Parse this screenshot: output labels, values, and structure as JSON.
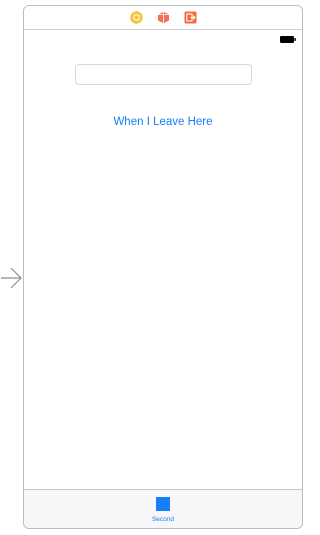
{
  "scene": {
    "dock_icons": [
      "view-controller-icon",
      "first-responder-icon",
      "exit-icon"
    ],
    "status_bar": {
      "battery_icon": "battery-icon"
    },
    "text_field": {
      "value": "",
      "placeholder": ""
    },
    "button": {
      "label": "When I Leave Here"
    },
    "tab_bar": {
      "items": [
        {
          "label": "Second",
          "icon": "square-icon",
          "selected": true
        }
      ]
    }
  },
  "colors": {
    "accent": "#147EFB",
    "dock_view_controller": "#F5C33B",
    "dock_first_responder": "#F0705A",
    "dock_exit": "#F26A3B"
  },
  "entry_arrow": {
    "icon": "initial-view-controller-arrow-icon"
  }
}
